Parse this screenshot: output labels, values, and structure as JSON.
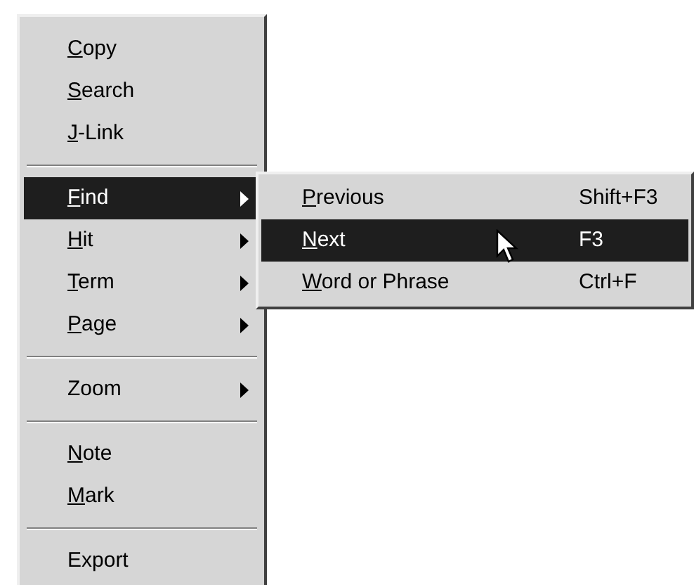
{
  "context_menu": {
    "items": [
      {
        "kind": "item",
        "label": "Copy",
        "mnemonic": true,
        "has_submenu": false,
        "selected": false
      },
      {
        "kind": "item",
        "label": "Search",
        "mnemonic": true,
        "has_submenu": false,
        "selected": false
      },
      {
        "kind": "item",
        "label": "J-Link",
        "mnemonic": true,
        "has_submenu": false,
        "selected": false
      },
      {
        "kind": "separator"
      },
      {
        "kind": "item",
        "label": "Find",
        "mnemonic": true,
        "has_submenu": true,
        "selected": true
      },
      {
        "kind": "item",
        "label": "Hit",
        "mnemonic": true,
        "has_submenu": true,
        "selected": false
      },
      {
        "kind": "item",
        "label": "Term",
        "mnemonic": true,
        "has_submenu": true,
        "selected": false
      },
      {
        "kind": "item",
        "label": "Page",
        "mnemonic": true,
        "has_submenu": true,
        "selected": false
      },
      {
        "kind": "separator"
      },
      {
        "kind": "item",
        "label": "Zoom",
        "mnemonic": false,
        "has_submenu": true,
        "selected": false
      },
      {
        "kind": "separator"
      },
      {
        "kind": "item",
        "label": "Note",
        "mnemonic": true,
        "has_submenu": false,
        "selected": false
      },
      {
        "kind": "item",
        "label": "Mark",
        "mnemonic": true,
        "has_submenu": false,
        "selected": false
      },
      {
        "kind": "separator"
      },
      {
        "kind": "item",
        "label": "Export",
        "mnemonic": false,
        "has_submenu": false,
        "selected": false
      }
    ]
  },
  "submenu": {
    "items": [
      {
        "label": "Previous",
        "mnemonic": true,
        "shortcut": "Shift+F3",
        "selected": false
      },
      {
        "label": "Next",
        "mnemonic": true,
        "shortcut": "F3",
        "selected": true
      },
      {
        "label": "Word or Phrase",
        "mnemonic": true,
        "shortcut": "Ctrl+F",
        "selected": false
      }
    ]
  }
}
